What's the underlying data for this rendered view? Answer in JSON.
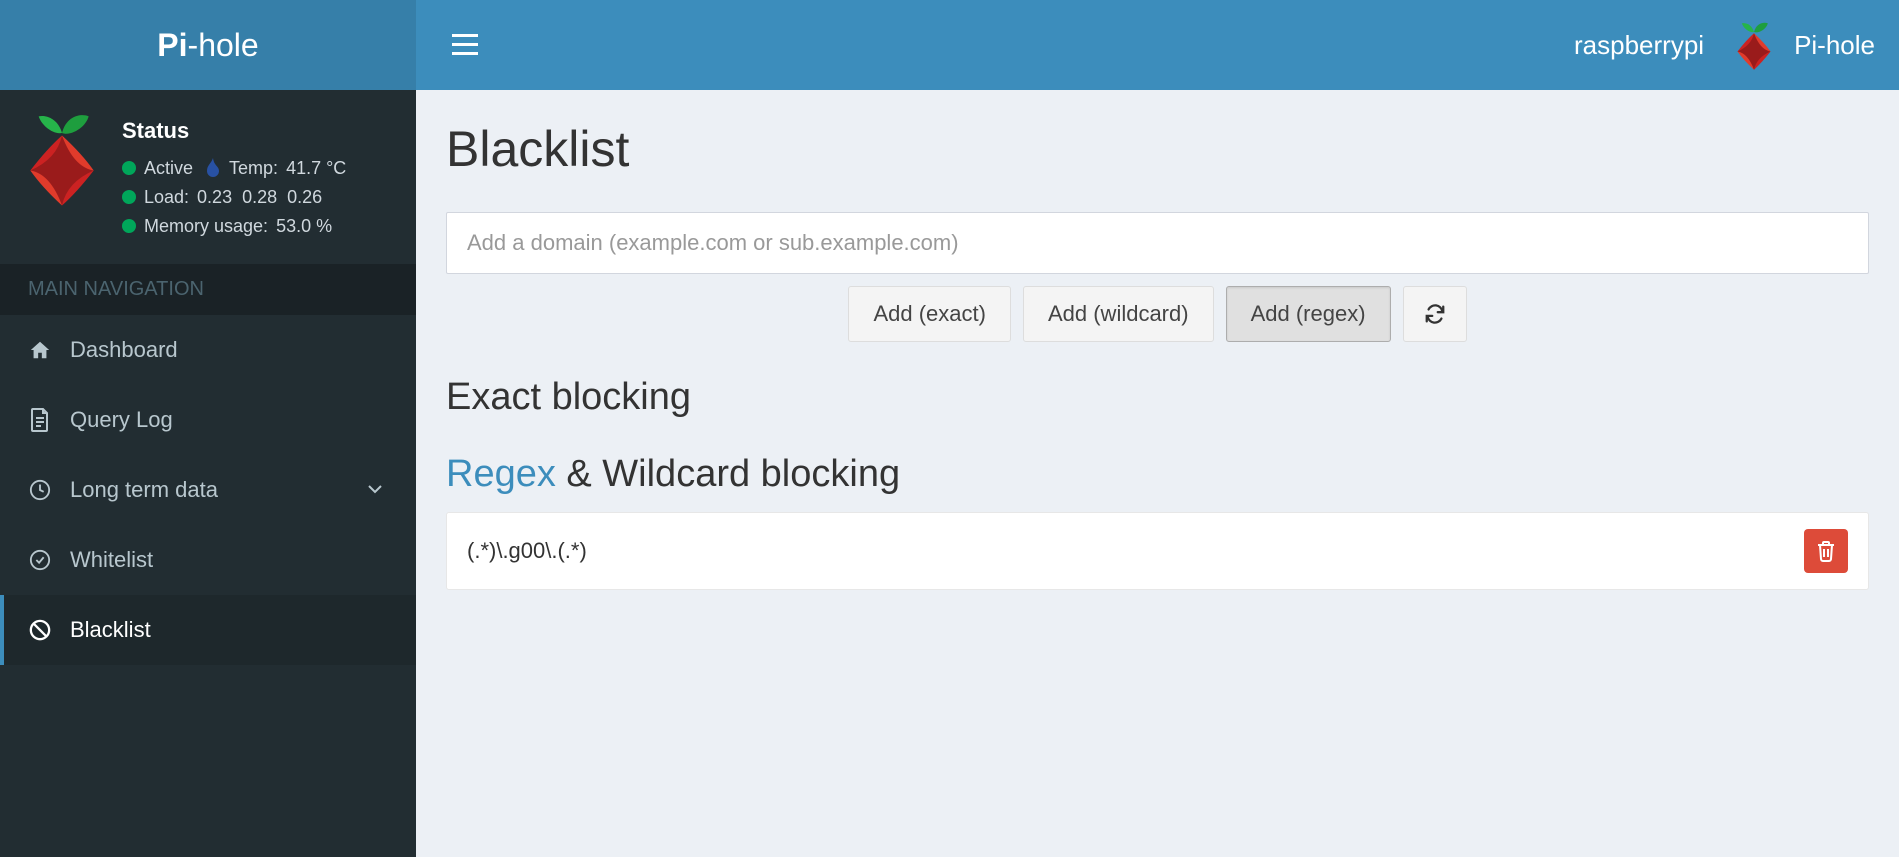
{
  "brand": {
    "bold": "Pi",
    "suffix": "-hole"
  },
  "header": {
    "hostname": "raspberrypi",
    "appname": "Pi-hole"
  },
  "status": {
    "title": "Status",
    "active_label": "Active",
    "temp_label": "Temp:",
    "temp_value": "41.7 °C",
    "load_label": "Load:",
    "load_values": "0.23  0.28  0.26",
    "mem_label": "Memory usage:",
    "mem_value": "53.0 %"
  },
  "nav": {
    "header": "MAIN NAVIGATION",
    "items": [
      {
        "label": "Dashboard"
      },
      {
        "label": "Query Log"
      },
      {
        "label": "Long term data"
      },
      {
        "label": "Whitelist"
      },
      {
        "label": "Blacklist"
      }
    ]
  },
  "page": {
    "title": "Blacklist",
    "input_placeholder": "Add a domain (example.com or sub.example.com)",
    "btn_exact": "Add (exact)",
    "btn_wildcard": "Add (wildcard)",
    "btn_regex": "Add (regex)",
    "section_exact": "Exact blocking",
    "section_regex_link": "Regex",
    "section_regex_rest": " & Wildcard blocking",
    "entries": [
      {
        "pattern": "(.*)\\.g00\\.(.*)"
      }
    ]
  }
}
